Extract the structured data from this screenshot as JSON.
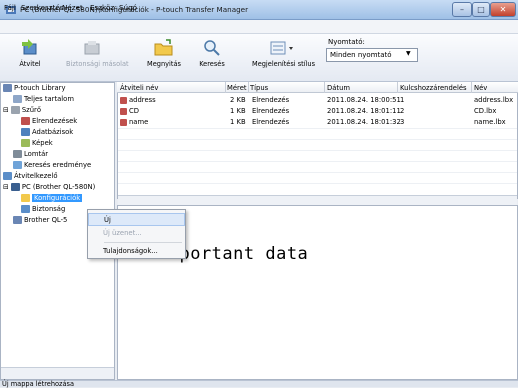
{
  "window": {
    "title": "PC (Brother QL-580N)\\Konfigurációk - P-touch Transfer Manager"
  },
  "menu": [
    "Fájl",
    "Szerkesztés",
    "Nézet",
    "Eszköz",
    "Súgó"
  ],
  "toolbar": {
    "transfer": "Átvitel",
    "backup": "Biztonsági másolat",
    "open": "Megnyitás",
    "search": "Keresés",
    "view_style": "Megjelenítési stílus",
    "printer_label": "Nyomtató:",
    "printer_value": "Minden nyomtató"
  },
  "tree": [
    {
      "label": "P-touch Library"
    },
    {
      "label": "Teljes tartalom"
    },
    {
      "label": "Szűrő"
    },
    {
      "label": "Elrendezések"
    },
    {
      "label": "Adatbázisok"
    },
    {
      "label": "Képek"
    },
    {
      "label": "Lomtár"
    },
    {
      "label": "Keresés eredménye"
    },
    {
      "label": "Átvitelkezelő"
    },
    {
      "label": "PC (Brother QL-580N)"
    },
    {
      "label": "Konfigurációk"
    },
    {
      "label": "Biztonság"
    },
    {
      "label": "Brother QL-5"
    }
  ],
  "table": {
    "headers": [
      "Átviteli név",
      "Méret",
      "Típus",
      "Dátum",
      "Kulcshozzárendelés",
      "Név"
    ],
    "rows": [
      [
        "address",
        "2 KB",
        "Elrendezés",
        "2011.08.24. 18:00:51",
        "1",
        "address.lbx"
      ],
      [
        "CD",
        "1 KB",
        "Elrendezés",
        "2011.08.24. 18:01:11",
        "2",
        "CD.lbx"
      ],
      [
        "name",
        "1 KB",
        "Elrendezés",
        "2011.08.24. 18:01:32",
        "3",
        "name.lbx"
      ]
    ]
  },
  "preview": {
    "text": "important data"
  },
  "context_menu": {
    "new": "Új",
    "new_message": "Új üzenet...",
    "properties": "Tulajdonságok..."
  },
  "status": {
    "text": "Új mappa létrehozása"
  },
  "colors": {
    "title_bar": "#b7d0ee",
    "selection": "#3399ff",
    "close_button": "#c2402c"
  }
}
